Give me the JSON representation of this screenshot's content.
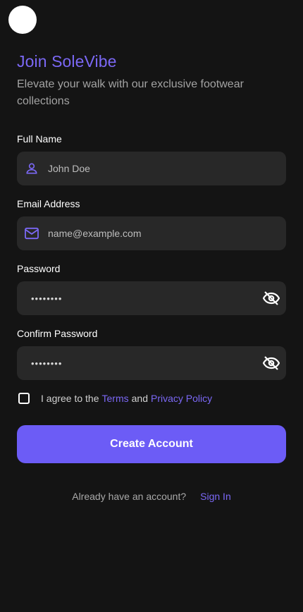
{
  "header": {
    "title": "Join SoleVibe",
    "subtitle": "Elevate your walk with our exclusive footwear collections"
  },
  "form": {
    "full_name": {
      "label": "Full Name",
      "placeholder": "John Doe",
      "icon": "person-icon"
    },
    "email": {
      "label": "Email Address",
      "placeholder": "name@example.com",
      "icon": "mail-icon"
    },
    "password": {
      "label": "Password",
      "value": "••••••••",
      "icon": "eye-off-icon"
    },
    "confirm_password": {
      "label": "Confirm Password",
      "value": "••••••••",
      "icon": "eye-off-icon"
    }
  },
  "agreement": {
    "prefix": "I agree to the",
    "terms": "Terms",
    "and": "and",
    "privacy": "Privacy Policy",
    "checked": false
  },
  "actions": {
    "create_label": "Create Account",
    "signin_prompt": "Already have an account?",
    "signin_label": "Sign In"
  },
  "colors": {
    "accent": "#7b68f5",
    "button": "#6c5cf6",
    "background": "#141414",
    "field": "#282828"
  }
}
